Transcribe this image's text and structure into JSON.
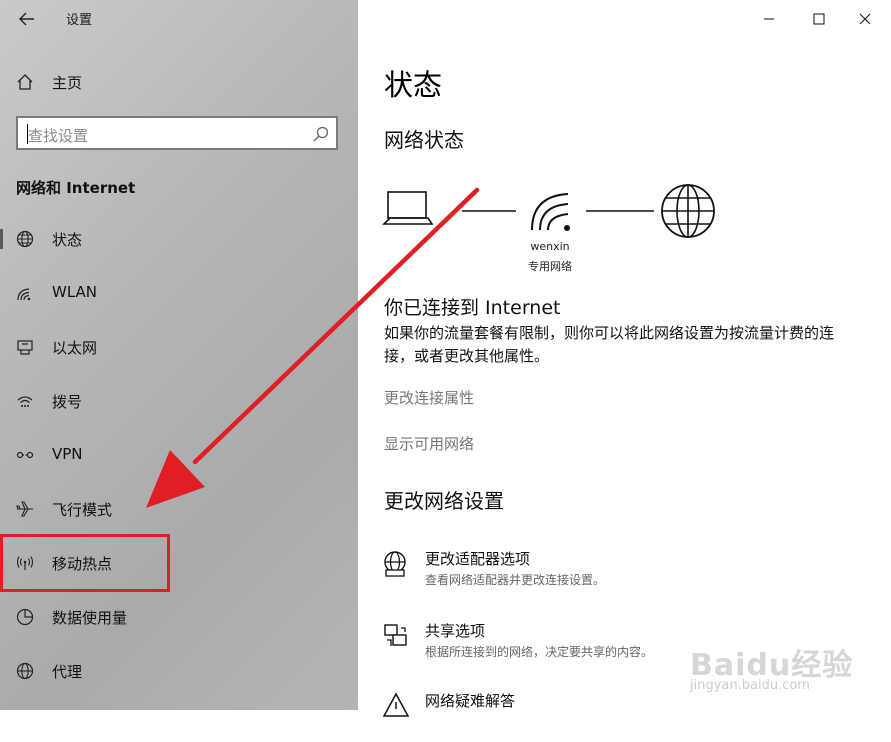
{
  "window": {
    "title": "设置",
    "controls": [
      "minimize-icon",
      "maximize-icon",
      "close-icon"
    ]
  },
  "sidebar": {
    "home_label": "主页",
    "search_placeholder": "查找设置",
    "section_title": "网络和 Internet",
    "items": [
      {
        "label": "状态",
        "icon": "globe-icon",
        "active": true
      },
      {
        "label": "WLAN",
        "icon": "wifi-icon",
        "active": false
      },
      {
        "label": "以太网",
        "icon": "ethernet-icon",
        "active": false
      },
      {
        "label": "拨号",
        "icon": "dialup-icon",
        "active": false
      },
      {
        "label": "VPN",
        "icon": "vpn-icon",
        "active": false
      },
      {
        "label": "飞行模式",
        "icon": "airplane-icon",
        "active": false
      },
      {
        "label": "移动热点",
        "icon": "hotspot-icon",
        "active": false
      },
      {
        "label": "数据使用量",
        "icon": "data-usage-icon",
        "active": false
      },
      {
        "label": "代理",
        "icon": "proxy-globe-icon",
        "active": false
      }
    ]
  },
  "main": {
    "page_title": "状态",
    "network_status_heading": "网络状态",
    "network_diagram": {
      "ssid": "wenxin",
      "profile_type": "专用网络",
      "icons": [
        "laptop-icon",
        "wifi-icon",
        "globe-icon"
      ]
    },
    "connection_title": "你已连接到 Internet",
    "connection_desc": "如果你的流量套餐有限制，则你可以将此网络设置为按流量计费的连接，或者更改其他属性。",
    "links": {
      "change_props": "更改连接属性",
      "show_networks": "显示可用网络"
    },
    "change_settings_heading": "更改网络设置",
    "options": [
      {
        "title": "更改适配器选项",
        "desc": "查看网络适配器并更改连接设置。",
        "icon": "adapter-icon"
      },
      {
        "title": "共享选项",
        "desc": "根据所连接到的网络，决定要共享的内容。",
        "icon": "sharing-icon"
      },
      {
        "title": "网络疑难解答",
        "desc": "",
        "icon": "warning-icon"
      }
    ]
  },
  "annotation": {
    "highlight_target": "移动热点",
    "arrow_color": "#e01e24"
  },
  "watermark": {
    "brand": "Baidu经验",
    "url": "jingyan.baidu.com"
  },
  "colors": {
    "sidebar_bg": "#b7b8ba",
    "link_gray": "#767676",
    "accent_red": "#e01e24"
  }
}
